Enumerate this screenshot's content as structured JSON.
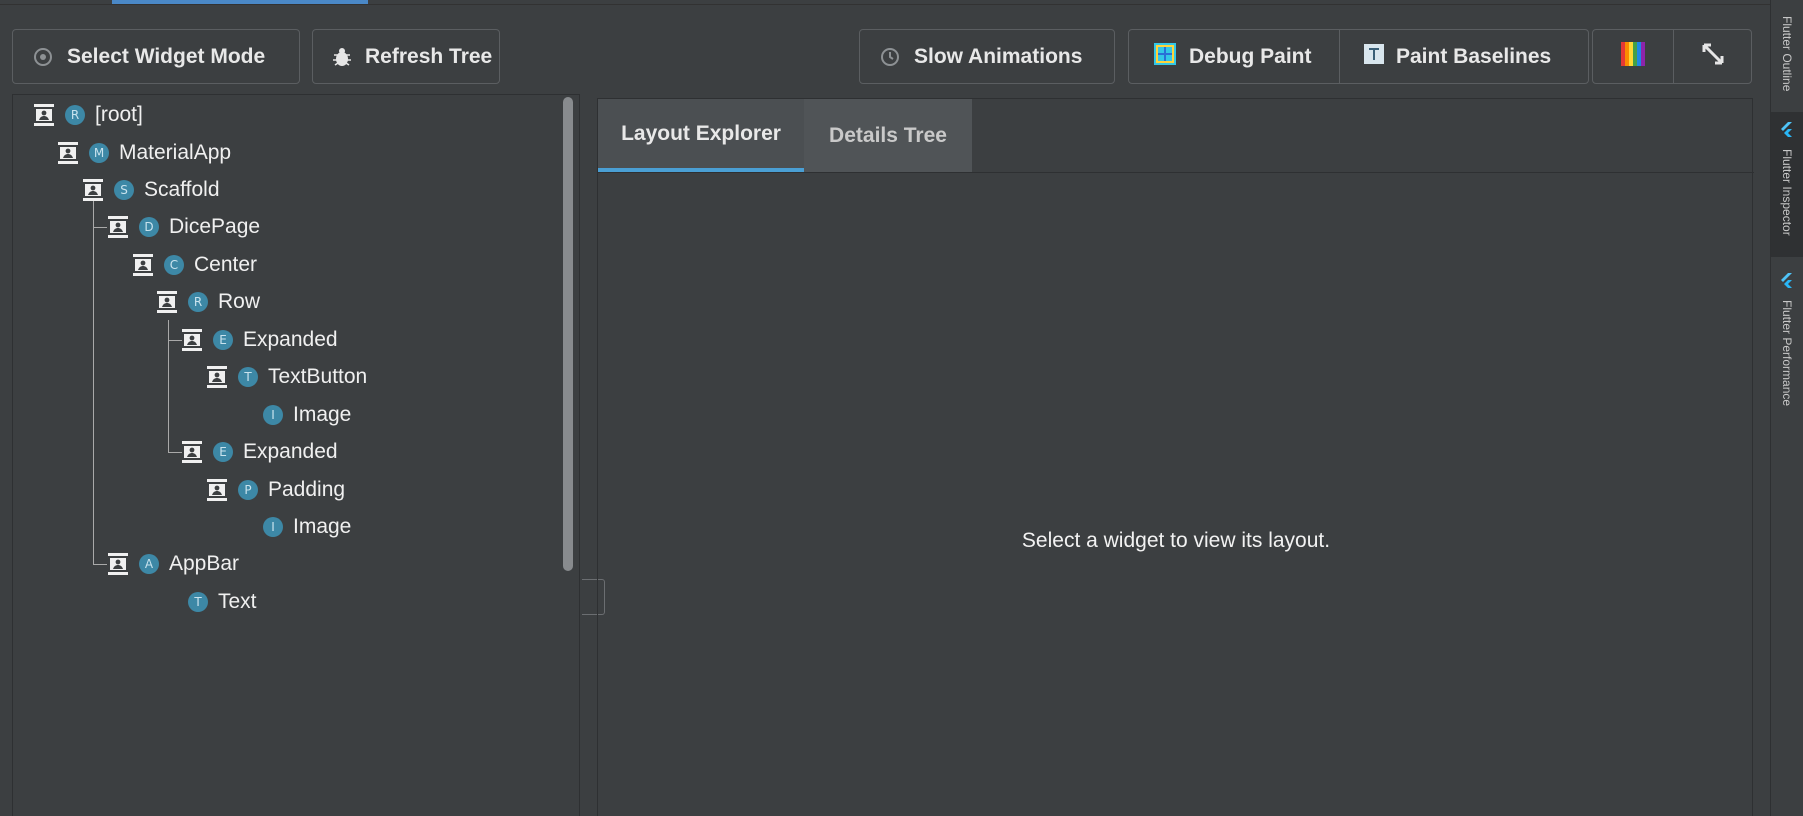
{
  "toolbar": {
    "select_widget_mode": "Select Widget Mode",
    "refresh_tree": "Refresh Tree",
    "slow_animations": "Slow Animations",
    "debug_paint": "Debug Paint",
    "paint_baselines": "Paint Baselines"
  },
  "tree": {
    "nodes": [
      {
        "label": "[root]",
        "badge": "R"
      },
      {
        "label": "MaterialApp",
        "badge": "M"
      },
      {
        "label": "Scaffold",
        "badge": "S"
      },
      {
        "label": "DicePage",
        "badge": "D"
      },
      {
        "label": "Center",
        "badge": "C"
      },
      {
        "label": "Row",
        "badge": "R"
      },
      {
        "label": "Expanded",
        "badge": "E"
      },
      {
        "label": "TextButton",
        "badge": "T"
      },
      {
        "label": "Image",
        "badge": "I"
      },
      {
        "label": "Expanded",
        "badge": "E"
      },
      {
        "label": "Padding",
        "badge": "P"
      },
      {
        "label": "Image",
        "badge": "I"
      },
      {
        "label": "AppBar",
        "badge": "A"
      },
      {
        "label": "Text",
        "badge": "T"
      }
    ]
  },
  "tabs": [
    {
      "label": "Layout Explorer",
      "active": true
    },
    {
      "label": "Details Tree",
      "active": false
    }
  ],
  "layout_explorer": {
    "empty_message": "Select a widget to view its layout."
  },
  "side_tabs": [
    {
      "label": "Flutter Outline",
      "active": false
    },
    {
      "label": "Flutter Inspector",
      "active": true
    },
    {
      "label": "Flutter Performance",
      "active": false
    }
  ],
  "colors": {
    "background": "#3c3f41",
    "accent": "#4a9fd4",
    "badge": "#3d88a6"
  }
}
